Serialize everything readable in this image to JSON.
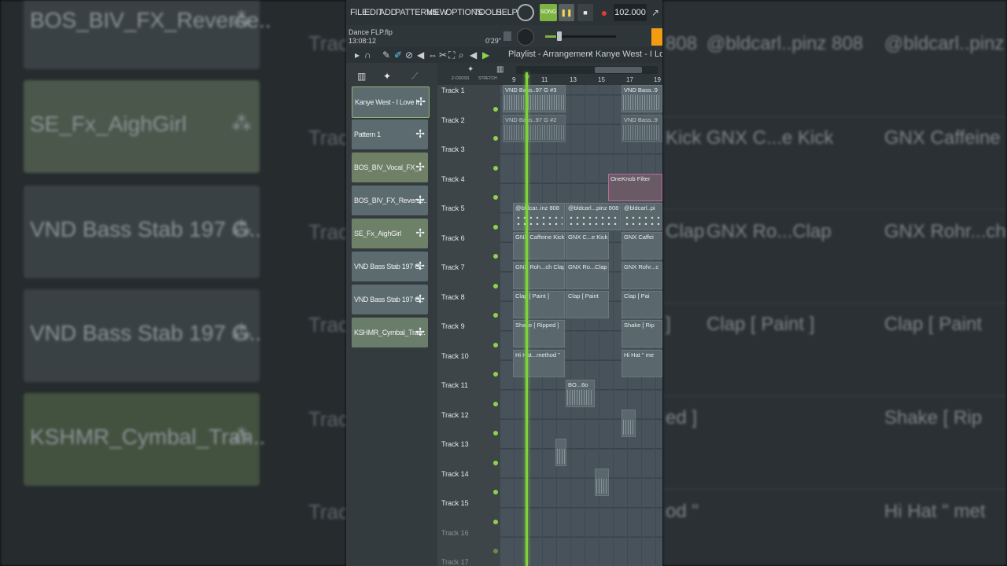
{
  "background_left": {
    "clips": [
      "BOS_BIV_FX_Reverse..",
      "SE_Fx_AighGirl",
      "VND Bass Stab 197 G..",
      "VND Bass Stab 197 G..",
      "KSHMR_Cymbal_Tran.."
    ],
    "track_hint": "Trac"
  },
  "background_right": {
    "cells": [
      [
        "808",
        "@bldcarl..pinz 808",
        "@bldcarl..pinz 808"
      ],
      [
        "Kick",
        "GNX C...e Kick",
        "GNX Caffeine"
      ],
      [
        "Clap",
        "GNX Ro...Clap",
        "GNX Rohr...ch"
      ],
      [
        "]",
        "Clap [ Paint ]",
        "Clap [ Paint"
      ],
      [
        "ed ]",
        "",
        "Shake [ Rip"
      ],
      [
        "od \"",
        "",
        "Hi Hat \" met"
      ]
    ]
  },
  "menubar": {
    "items": [
      "FILE",
      "EDIT",
      "ADD",
      "PATTERNS",
      "VIEW",
      "OPTIONS",
      "TOOLS",
      "HELP"
    ],
    "song_mode": "SONG",
    "tempo": "102.000"
  },
  "info": {
    "project_name": "Dance FLP.flp",
    "clock": "13:08:12",
    "duration": "0'29\""
  },
  "playlist": {
    "title": "Playlist - Arrangement",
    "separator": "›",
    "pattern": "Kanye West - I Love It",
    "ruler_marks": [
      "9",
      "11",
      "13",
      "15",
      "17",
      "19"
    ],
    "z_cross": "Z-CROSS",
    "stretch": "STRETCH"
  },
  "browser": {
    "patterns": [
      {
        "label": "Kanye West - I Love It",
        "color": "#64736f"
      },
      {
        "label": "Pattern 1",
        "color": "#5c686c"
      },
      {
        "label": "BOS_BIV_Vocal_FX_..",
        "color": "#6f8067"
      },
      {
        "label": "BOS_BIV_FX_Reverse..",
        "color": "#5f6d72"
      },
      {
        "label": "SE_Fx_AighGirl",
        "color": "#6d8068"
      },
      {
        "label": "VND Bass Stab 197 G..",
        "color": "#5d6a6f"
      },
      {
        "label": "VND Bass Stab 197 G..",
        "color": "#5d6a6f"
      },
      {
        "label": "KSHMR_Cymbal_Tran..",
        "color": "#6a7d6a"
      }
    ]
  },
  "tracks": [
    "Track 1",
    "Track 2",
    "Track 3",
    "Track 4",
    "Track 5",
    "Track 6",
    "Track 7",
    "Track 8",
    "Track 9",
    "Track 10",
    "Track 11",
    "Track 12",
    "Track 13",
    "Track 14",
    "Track 15",
    "Track 16",
    "Track 17"
  ],
  "clips": {
    "t1a": "VND Bass..97 G #3",
    "t1b": "VND Bass..9",
    "t2a": "VND Bass..97 G #2",
    "t2b": "VND Bass..9",
    "t4": "OneKnob Filter",
    "t5a": "@bldcar..inz 808",
    "t5b": "@bldcarl...pinz 808",
    "t5c": "@bldcarl..pi",
    "t6a": "GNX Caffeine Kick",
    "t6b": "GNX C...e Kick",
    "t6c": "GNX Caffei",
    "t7a": "GNX Roh...ch Clap",
    "t7b": "GNX Ro...Clap",
    "t7c": "GNX Rohr...c",
    "t8a": "Clap [ Paint ]",
    "t8b": "Clap [ Paint",
    "t8c": "Clap [ Pai",
    "t9a": "Shake [ Ripped ]",
    "t9b": "Shake [ Rip",
    "t10a": "Hi Hat...method \"",
    "t10b": "Hi Hat \" me",
    "t11": "BO...6o"
  }
}
